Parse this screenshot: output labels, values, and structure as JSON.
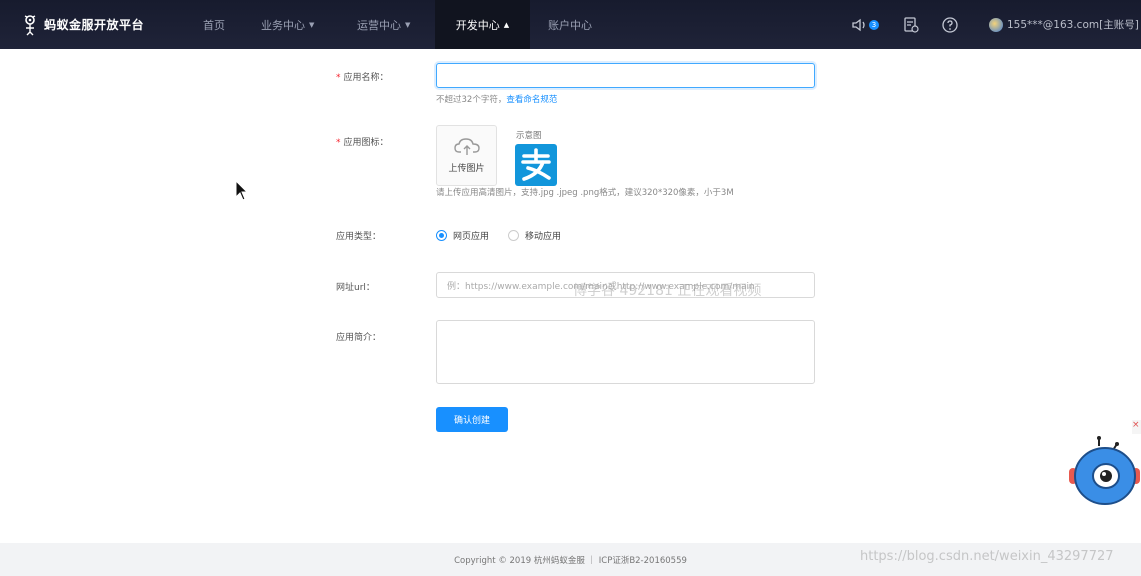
{
  "header": {
    "brand": "蚂蚁金服开放平台",
    "nav": [
      {
        "label": "首页",
        "has_caret": false
      },
      {
        "label": "业务中心",
        "has_caret": true
      },
      {
        "label": "运营中心",
        "has_caret": true
      },
      {
        "label": "开发中心",
        "has_caret": true,
        "active": true
      },
      {
        "label": "账户中心",
        "has_caret": false
      }
    ],
    "notification_count": "3",
    "user": "155***@163.com[主账号]",
    "icons": [
      "speaker-icon",
      "document-icon",
      "help-icon"
    ]
  },
  "form": {
    "app_name": {
      "label": "应用名称：",
      "value": "",
      "hint_text": "不超过32个字符，",
      "hint_link": "查看命名规范"
    },
    "app_icon": {
      "label": "应用图标：",
      "upload_text": "上传图片",
      "sample_label": "示意图",
      "hint": "请上传应用高清图片，支持.jpg .jpeg .png格式，建议320*320像素，小于3M"
    },
    "app_type": {
      "label": "应用类型：",
      "options": [
        "网页应用",
        "移动应用"
      ],
      "selected": "网页应用"
    },
    "url": {
      "label": "网址url：",
      "placeholder": "例：https://www.example.com/main或http://www.example.com/main"
    },
    "intro": {
      "label": "应用简介："
    },
    "submit": "确认创建"
  },
  "watermark": "博学谷 492181 正在观看视频",
  "footer": "Copyright © 2019 杭州蚂蚁金服 ｜ ICP证浙B2-20160559",
  "blog_watermark": "https://blog.csdn.net/weixin_43297727",
  "colors": {
    "primary": "#1890ff",
    "topbar": "#1b1f33",
    "required": "#f5222d"
  }
}
